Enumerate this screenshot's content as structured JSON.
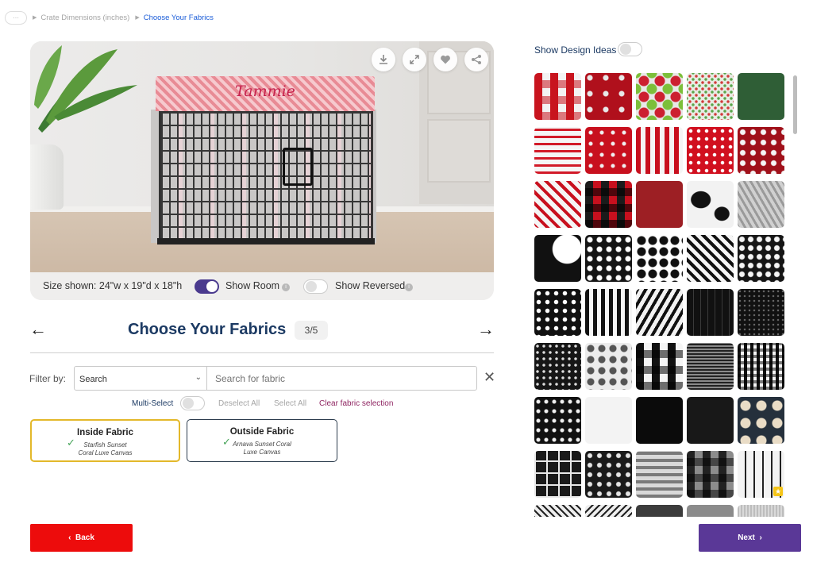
{
  "breadcrumb": {
    "home_icon": "ellipsis-icon",
    "items": [
      "Crate Dimensions (inches)",
      "Choose Your Fabrics"
    ]
  },
  "preview": {
    "crate_name": "Tammie",
    "size_shown": "Size shown: 24\"w x 19\"d x 18\"h",
    "show_room_label": "Show Room",
    "show_room_on": true,
    "show_reversed_label": "Show Reversed",
    "show_reversed_on": false,
    "actions": [
      "download-icon",
      "fullscreen-icon",
      "heart-icon",
      "share-icon"
    ]
  },
  "step": {
    "title": "Choose Your Fabrics",
    "count": "3/5"
  },
  "filter": {
    "label": "Filter by:",
    "select_value": "Search",
    "search_placeholder": "Search for fabric",
    "multi_select_label": "Multi-Select",
    "multi_select_on": false,
    "deselect_all": "Deselect All",
    "select_all": "Select All",
    "clear_selection": "Clear fabric selection"
  },
  "selection": {
    "inside": {
      "title": "Inside Fabric",
      "line1": "Starfish Sunset",
      "line2": "Coral Luxe Canvas"
    },
    "outside": {
      "title": "Outside Fabric",
      "line1": "Arnava Sunset Coral",
      "line2": "Luxe Canvas"
    }
  },
  "buttons": {
    "back": "Back",
    "next": "Next"
  },
  "design_ideas": {
    "label": "Show Design Ideas",
    "on": false
  },
  "colors": {
    "brand_navy": "#1c3a63",
    "next_purple": "#5a3897",
    "back_red": "#ed0c0c",
    "toggle_on": "#4a3a8e",
    "inside_border": "#e3b82a"
  },
  "swatches": [
    {
      "name": "red-white-buffalo-check",
      "bg": "repeating-linear-gradient(0deg, rgba(200,20,30,.55) 0 10px, transparent 10px 20px), repeating-linear-gradient(90deg, #c8141e 0 10px, #f3f3f3 10px 20px)"
    },
    {
      "name": "red-deer-antlers",
      "bg": "radial-gradient(circle at 30% 30%, #e8e8e8 0 3px, transparent 4px) 0 0/20px 20px, #b0101c"
    },
    {
      "name": "holiday-ornament-dots",
      "bg": "radial-gradient(circle, #cc2030 0 6px, transparent 7px) 0 0/20px 20px, radial-gradient(circle, #7cbf3a 0 6px, transparent 7px) 10px 10px/20px 20px, #e8e8e8"
    },
    {
      "name": "mini-holiday-dots",
      "bg": "radial-gradient(circle, #d23a3a 0 1.5px, transparent 2px) 0 0/8px 8px, radial-gradient(circle, #5aa64a 0 1.5px, transparent 2px) 4px 4px/8px 8px, #e7ebe3"
    },
    {
      "name": "green-solid",
      "bg": "#2f5e36"
    },
    {
      "name": "ho-ho-ho-text",
      "bg": "repeating-linear-gradient(0deg, #d21a28 0 3px, #f5f5f5 3px 9px)"
    },
    {
      "name": "red-starburst",
      "bg": "radial-gradient(circle, #f0f0f0 0 2px, transparent 3px) 0 0/14px 14px, #c8101e"
    },
    {
      "name": "red-white-stripes",
      "bg": "repeating-linear-gradient(90deg, #c8101e 0 6px, #f5f5f5 6px 12px)"
    },
    {
      "name": "red-white-dots",
      "bg": "radial-gradient(circle, #ffffff 0 2px, transparent 2.5px) 0 0/10px 10px, #d1101f"
    },
    {
      "name": "red-paisley",
      "bg": "radial-gradient(circle, #f5f5f5 0 3px, transparent 4px) 0 0/13px 13px, #a0101a"
    },
    {
      "name": "red-chevron",
      "bg": "repeating-linear-gradient(45deg, #c8101e 0 4px, #f5f5f5 4px 10px)"
    },
    {
      "name": "red-black-buffalo-check",
      "bg": "repeating-linear-gradient(0deg, rgba(0,0,0,.6) 0 10px, transparent 10px 20px), repeating-linear-gradient(90deg, #1b1b1b 0 10px, #c8101e 10px 20px)"
    },
    {
      "name": "burgundy-solid",
      "bg": "#9d1f24"
    },
    {
      "name": "cow-print",
      "bg": "radial-gradient(ellipse at 30% 40%, #111 0 12px, transparent 13px), radial-gradient(ellipse at 75% 70%, #111 0 9px, transparent 10px), #f2f2f2"
    },
    {
      "name": "grey-marble",
      "bg": "repeating-linear-gradient(60deg, #9a9a9a 0 3px, #d0d0d0 3px 7px)"
    },
    {
      "name": "black-white-abstract",
      "bg": "radial-gradient(ellipse at 70% 30%, #fff 0 18px, transparent 19px), #111"
    },
    {
      "name": "black-white-damask",
      "bg": "radial-gradient(circle, #ffffff 0 3px, transparent 4px) 0 0/12px 12px, #151515"
    },
    {
      "name": "black-quatrefoil",
      "bg": "radial-gradient(circle, #111 0 5px, transparent 6px) 0 0/14px 14px, #ffffff"
    },
    {
      "name": "black-white-chevron",
      "bg": "repeating-linear-gradient(45deg, #111 0 4px, #f5f5f5 4px 9px)"
    },
    {
      "name": "black-white-paisley",
      "bg": "radial-gradient(circle, #f5f5f5 0 3px, transparent 4px) 0 0/11px 11px, #161616"
    },
    {
      "name": "black-white-polka-dot",
      "bg": "radial-gradient(circle, #ffffff 0 2.5px, transparent 3px) 0 0/11px 11px, #111"
    },
    {
      "name": "black-white-stripes",
      "bg": "repeating-linear-gradient(90deg, #111 0 5px, #f5f5f5 5px 10px)"
    },
    {
      "name": "zebra-print",
      "bg": "repeating-linear-gradient(120deg, #111 0 4px, #f2f2f2 4px 9px)"
    },
    {
      "name": "black-pinstripe",
      "bg": "repeating-linear-gradient(90deg, #111 0 8px, #3a3a3a 8px 9px)"
    },
    {
      "name": "black-mini-dots",
      "bg": "radial-gradient(circle, #666 0 1px, transparent 1.5px) 0 0/6px 6px, #111"
    },
    {
      "name": "black-dot-pattern",
      "bg": "radial-gradient(circle, #ddd 0 1.5px, transparent 2px) 0 0/8px 8px, #161616"
    },
    {
      "name": "black-white-toile",
      "bg": "radial-gradient(circle, #555 0 4px, transparent 5px) 0 0/14px 14px, #ececec"
    },
    {
      "name": "black-white-buffalo-check",
      "bg": "repeating-linear-gradient(0deg, rgba(0,0,0,.55) 0 10px, transparent 10px 20px), repeating-linear-gradient(90deg, #111 0 10px, #f5f5f5 10px 20px)"
    },
    {
      "name": "black-houndstooth",
      "bg": "repeating-linear-gradient(0deg, #222 0 2px, #8a8a8a 2px 4px), #555"
    },
    {
      "name": "black-white-gingham",
      "bg": "repeating-linear-gradient(0deg, rgba(0,0,0,.5) 0 4px, transparent 4px 8px), repeating-linear-gradient(90deg, #111 0 4px, #f5f5f5 4px 8px)"
    },
    {
      "name": "black-bunny-print",
      "bg": "radial-gradient(circle, #f0f0f0 0 2px, transparent 3px) 0 0/10px 12px, #111"
    },
    {
      "name": "white-solid",
      "bg": "#f3f3f3"
    },
    {
      "name": "black-solid",
      "bg": "#0b0b0b"
    },
    {
      "name": "black-canvas",
      "bg": "#181818"
    },
    {
      "name": "navy-dog-print",
      "bg": "radial-gradient(circle, #e9dcc6 0 6px, transparent 7px) 0 0/20px 22px, #25303c"
    },
    {
      "name": "black-windowpane",
      "bg": "repeating-linear-gradient(0deg, #e8e8e8 0 2px, transparent 2px 15px), repeating-linear-gradient(90deg, #e8e8e8 0 2px, #1a1a1a 2px 15px)"
    },
    {
      "name": "black-floral",
      "bg": "radial-gradient(circle, #e5e5e5 0 2.5px, transparent 3.5px) 0 0/12px 12px, #1a1a1a"
    },
    {
      "name": "grey-watercolor-stripe",
      "bg": "repeating-linear-gradient(0deg, #7a7a7a 0 4px, #d9d9d9 4px 9px)"
    },
    {
      "name": "black-grey-buffalo-check",
      "bg": "repeating-linear-gradient(0deg, rgba(0,0,0,.5) 0 10px, transparent 10px 20px), repeating-linear-gradient(90deg, #222 0 10px, #8c8c8c 10px 20px)"
    },
    {
      "name": "white-black-ticking-stripe",
      "bg": "repeating-linear-gradient(90deg, #f3f3f3 0 9px, #222 9px 11px)"
    },
    {
      "name": "black-white-geometric",
      "bg": "repeating-linear-gradient(45deg, #222 0 2px, #eee 2px 6px)"
    },
    {
      "name": "black-white-arrows",
      "bg": "repeating-linear-gradient(135deg, #222 0 2px, #eee 2px 6px)"
    },
    {
      "name": "charcoal-solid",
      "bg": "#3c3c3c"
    },
    {
      "name": "grey-solid",
      "bg": "#8b8b8b"
    },
    {
      "name": "grey-texture",
      "bg": "repeating-linear-gradient(90deg, #bdbdbd 0 2px, #d9d9d9 2px 4px)"
    }
  ]
}
